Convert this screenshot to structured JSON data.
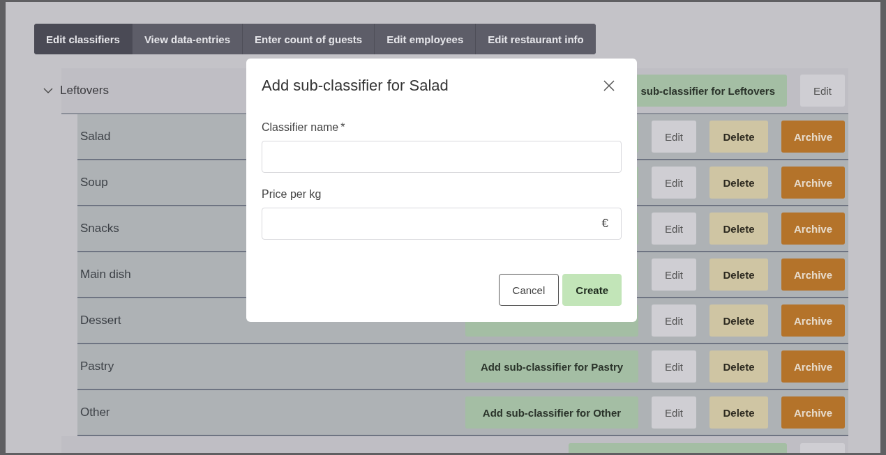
{
  "tabs": [
    {
      "label": "Edit classifiers",
      "selected": true
    },
    {
      "label": "View data-entries",
      "selected": false
    },
    {
      "label": "Enter count of guests",
      "selected": false
    },
    {
      "label": "Edit employees",
      "selected": false
    },
    {
      "label": "Edit restaurant info",
      "selected": false
    }
  ],
  "tree": [
    {
      "name": "Leftovers",
      "expanded": true,
      "add_label": "sub-classifier for Leftovers",
      "edit_label": "Edit",
      "children": [
        {
          "name": "Salad",
          "edit_label": "Edit",
          "delete_label": "Delete",
          "archive_label": "Archive"
        },
        {
          "name": "Soup",
          "edit_label": "Edit",
          "delete_label": "Delete",
          "archive_label": "Archive"
        },
        {
          "name": "Snacks",
          "edit_label": "Edit",
          "delete_label": "Delete",
          "archive_label": "Archive"
        },
        {
          "name": "Main dish",
          "edit_label": "Edit",
          "delete_label": "Delete",
          "archive_label": "Archive"
        },
        {
          "name": "Dessert",
          "edit_label": "Edit",
          "delete_label": "Delete",
          "archive_label": "Archive"
        },
        {
          "name": "Pastry",
          "add_label": "Add sub-classifier for Pastry",
          "edit_label": "Edit",
          "delete_label": "Delete",
          "archive_label": "Archive"
        },
        {
          "name": "Other",
          "add_label": "Add sub-classifier for Other",
          "edit_label": "Edit",
          "delete_label": "Delete",
          "archive_label": "Archive"
        }
      ]
    }
  ],
  "dialog": {
    "title": "Add sub-classifier for Salad",
    "fields": [
      {
        "label": "Classifier name",
        "required_mark": "*"
      },
      {
        "label": "Price per kg",
        "suffix": "€"
      }
    ],
    "buttons": [
      {
        "label": "Cancel",
        "kind": "secondary"
      },
      {
        "label": "Create",
        "kind": "primary"
      }
    ]
  }
}
